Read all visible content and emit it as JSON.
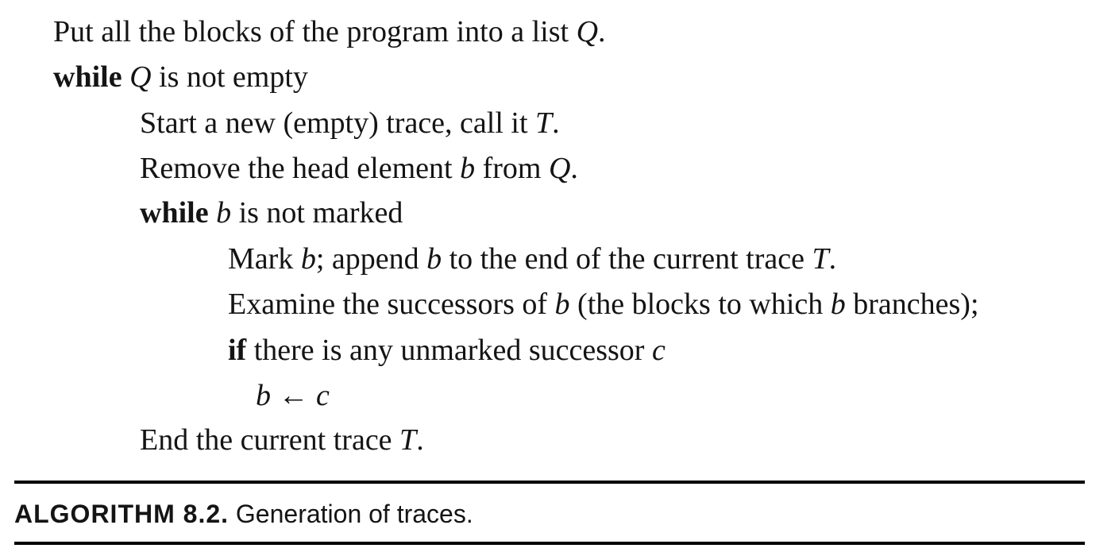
{
  "algorithm": {
    "lines": [
      {
        "segments": [
          "Put all the blocks of the program into a list ",
          "Q",
          "."
        ]
      },
      {
        "segments": [
          "while",
          " ",
          "Q",
          " is not empty"
        ]
      },
      {
        "segments": [
          "Start a new (empty) trace, call it ",
          "T",
          "."
        ]
      },
      {
        "segments": [
          "Remove the head element ",
          "b",
          " from ",
          "Q",
          "."
        ]
      },
      {
        "segments": [
          "while",
          " ",
          "b",
          " is not marked"
        ]
      },
      {
        "segments": [
          "Mark ",
          "b",
          "; append ",
          "b",
          " to the end of the current trace ",
          "T",
          "."
        ]
      },
      {
        "segments": [
          "Examine the successors of ",
          "b",
          " (the blocks to which ",
          "b",
          " branches);"
        ]
      },
      {
        "segments": [
          "if",
          " there is any unmarked successor ",
          "c"
        ]
      },
      {
        "segments": [
          "b",
          " ← ",
          "c"
        ]
      },
      {
        "segments": [
          "End the current trace ",
          "T",
          "."
        ]
      }
    ]
  },
  "caption": {
    "label": "ALGORITHM 8.2.",
    "text": " Generation of traces."
  }
}
